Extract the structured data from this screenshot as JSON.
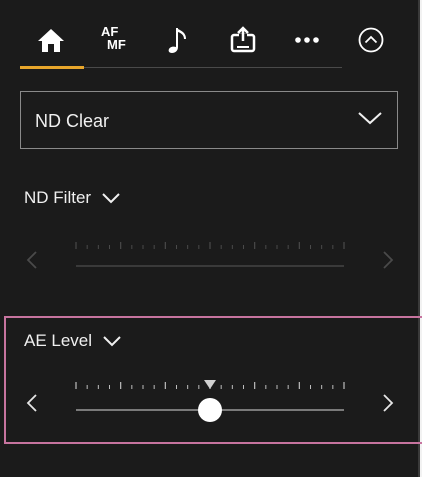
{
  "tabs": [
    {
      "id": "home",
      "icon": "home-icon",
      "active": true
    },
    {
      "id": "af-mf",
      "icon": "af-mf-icon",
      "line1": "AF",
      "line2": "MF"
    },
    {
      "id": "audio",
      "icon": "music-note-icon"
    },
    {
      "id": "media",
      "icon": "upload-icon"
    },
    {
      "id": "more",
      "icon": "more-icon"
    },
    {
      "id": "collapse",
      "icon": "chevron-up-circle-icon"
    }
  ],
  "accent_color": "#e8a62b",
  "highlight_color": "#c7749f",
  "nd_mode": {
    "selected": "ND Clear"
  },
  "nd_filter": {
    "label": "ND Filter",
    "enabled": false
  },
  "ae_level": {
    "label": "AE Level",
    "enabled": true,
    "value_fraction": 0.5
  }
}
